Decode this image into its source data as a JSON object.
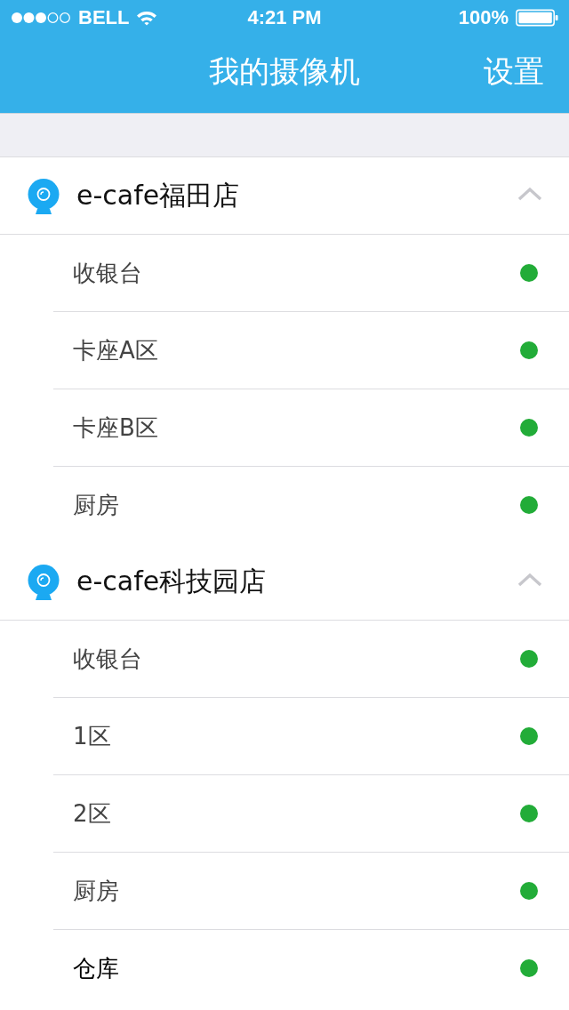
{
  "status_bar": {
    "carrier": "BELL",
    "time": "4:21 PM",
    "battery": "100%"
  },
  "nav_bar": {
    "title": "我的摄像机",
    "action": "设置"
  },
  "groups": [
    {
      "name": "e-cafe福田店",
      "expanded": true,
      "cameras": [
        {
          "name": "收银台",
          "online": true,
          "selected": false
        },
        {
          "name": "卡座A区",
          "online": true,
          "selected": false
        },
        {
          "name": "卡座B区",
          "online": true,
          "selected": false
        },
        {
          "name": "厨房",
          "online": true,
          "selected": false
        }
      ]
    },
    {
      "name": "e-cafe科技园店",
      "expanded": true,
      "cameras": [
        {
          "name": "收银台",
          "online": true,
          "selected": false
        },
        {
          "name": "1区",
          "online": true,
          "selected": false
        },
        {
          "name": "2区",
          "online": true,
          "selected": false
        },
        {
          "name": "厨房",
          "online": true,
          "selected": false
        },
        {
          "name": "仓库",
          "online": true,
          "selected": true
        }
      ]
    }
  ]
}
